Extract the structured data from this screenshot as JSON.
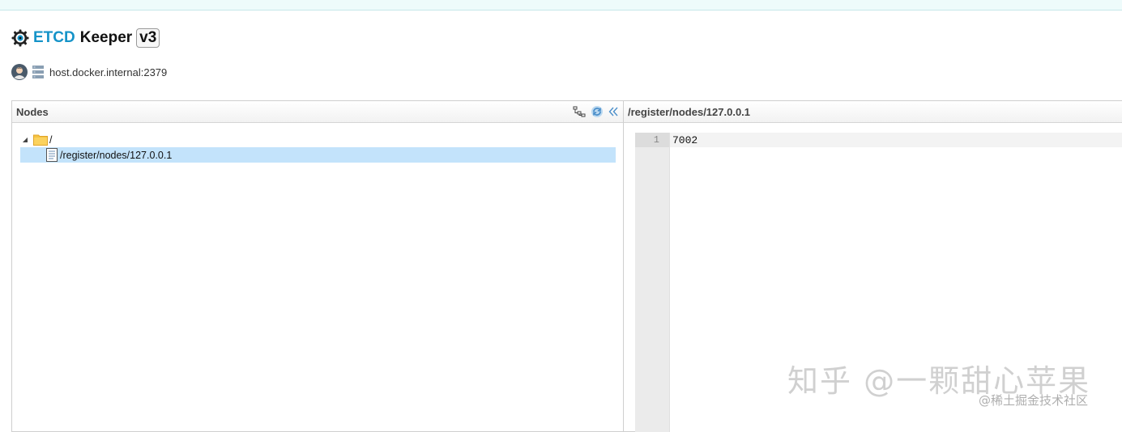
{
  "app": {
    "brand": "ETCD",
    "name": "Keeper",
    "version": "v3",
    "icons": {
      "logo": "gear-eye-icon",
      "avatar": "user-avatar-icon",
      "server": "server-stack-icon"
    }
  },
  "connection": {
    "host": "host.docker.internal:2379"
  },
  "nodes_panel": {
    "title": "Nodes",
    "tools": [
      "tree-structure-icon",
      "refresh-icon",
      "collapse-double-chevron-icon"
    ],
    "tree": {
      "root": {
        "label": "/",
        "icon": "folder-icon",
        "expanded": true
      },
      "children": [
        {
          "label": "/register/nodes/127.0.0.1",
          "icon": "file-icon",
          "selected": true
        }
      ]
    }
  },
  "editor_panel": {
    "title": "/register/nodes/127.0.0.1",
    "lines": [
      {
        "number": "1",
        "text": "7002"
      }
    ]
  },
  "watermark": {
    "main": "知乎 @一颗甜心苹果",
    "sub": "@稀土掘金技术社区"
  },
  "colors": {
    "brand": "#1593c8",
    "selection": "#c3e3fb",
    "folder": "#f6c342",
    "refresh": "#6aa7d8"
  }
}
